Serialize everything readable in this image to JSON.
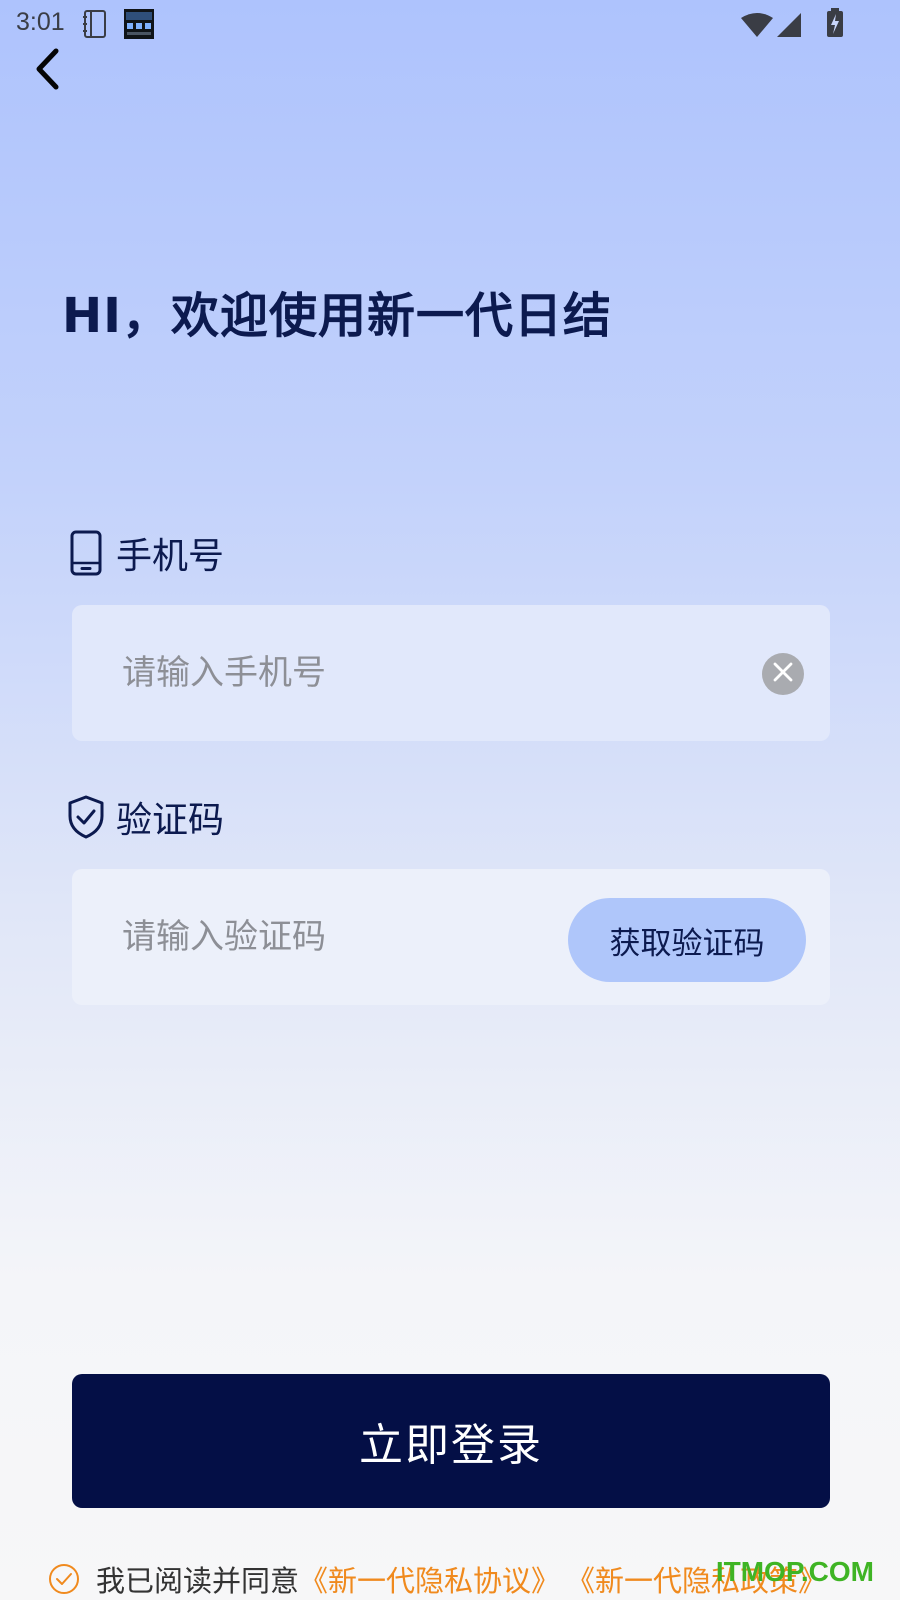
{
  "status_bar": {
    "time": "3:01",
    "icons": [
      "notebook-icon",
      "clock-widget-icon",
      "wifi-icon",
      "signal-icon",
      "battery-charging-icon"
    ]
  },
  "nav": {
    "back_icon": "chevron-left-icon"
  },
  "title": "HI，欢迎使用新一代日结",
  "phone": {
    "label": "手机号",
    "icon": "mobile-phone-icon",
    "placeholder": "请输入手机号",
    "value": "",
    "clear_icon": "clear-circle-icon"
  },
  "code": {
    "label": "验证码",
    "icon": "shield-check-icon",
    "placeholder": "请输入验证码",
    "value": "",
    "get_code_label": "获取验证码"
  },
  "login_label": "立即登录",
  "agreement": {
    "prefix": "我已阅读并同意",
    "link1": "《新一代隐私协议》",
    "link2": "《新一代隐私政策》",
    "check_icon": "check-circle-icon"
  },
  "watermark": "ITMOP.COM",
  "colors": {
    "primary": "#040f46",
    "title": "#0c1a4f",
    "accent_link": "#f08a1e",
    "code_button": "#afc6fa",
    "watermark": "#3fb424"
  }
}
